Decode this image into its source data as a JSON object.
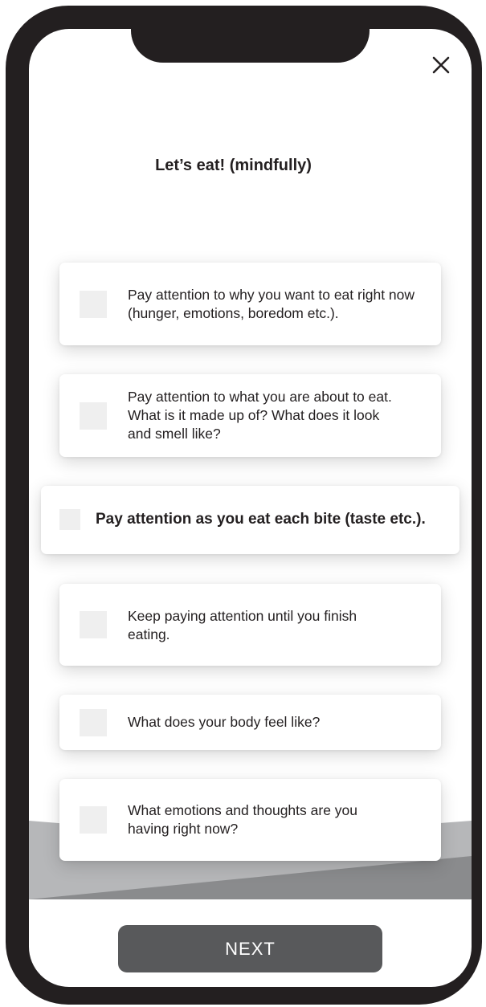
{
  "header": {
    "title": "Let’s eat! (mindfully)"
  },
  "icons": {
    "close": "close-icon"
  },
  "checklist": {
    "items": [
      {
        "label": "Pay attention to why you want to eat right now (hunger, emotions, boredom etc.).",
        "checked": false
      },
      {
        "label": "Pay attention to what you are about to eat. What is it made up of? What does it look and smell like?",
        "checked": false
      },
      {
        "label": "Pay attention as you eat each bite (taste etc.).",
        "checked": false,
        "highlighted": true
      },
      {
        "label": "Keep paying attention until you finish eating.",
        "checked": false
      },
      {
        "label": "What does your body feel like?",
        "checked": false
      },
      {
        "label": "What emotions and thoughts are you having right now?",
        "checked": false
      }
    ]
  },
  "footer": {
    "next_label": "NEXT"
  },
  "colors": {
    "frame": "#231f20",
    "checkbox": "#efefef",
    "button": "#58595b",
    "band_light": "#b6b7b9",
    "band_dark": "#8a8b8d"
  }
}
